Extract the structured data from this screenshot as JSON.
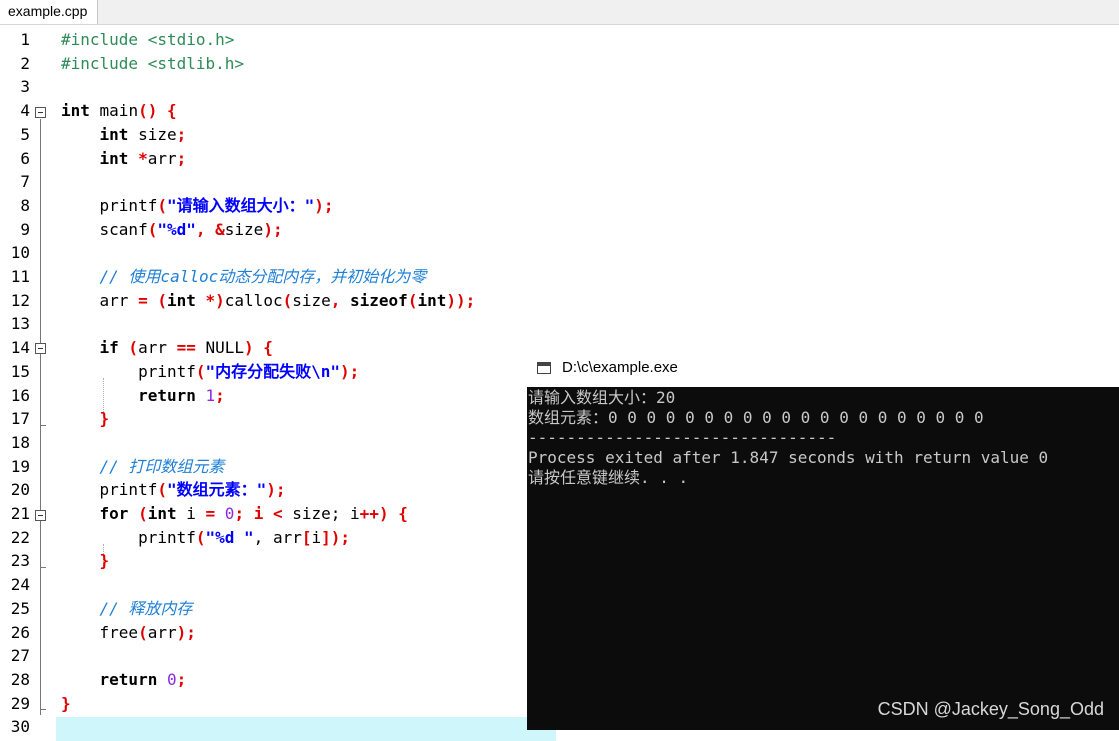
{
  "tab": {
    "label": "example.cpp"
  },
  "editor": {
    "line_numbers": [
      "1",
      "2",
      "3",
      "4",
      "5",
      "6",
      "7",
      "8",
      "9",
      "10",
      "11",
      "12",
      "13",
      "14",
      "15",
      "16",
      "17",
      "18",
      "19",
      "20",
      "21",
      "22",
      "23",
      "24",
      "25",
      "26",
      "27",
      "28",
      "29",
      "30"
    ],
    "lines": {
      "l1": {
        "a": "#include <stdio.h>"
      },
      "l2": {
        "a": "#include <stdlib.h>"
      },
      "l4": {
        "a": "int",
        "b": " main",
        "c": "() {"
      },
      "l5": {
        "a": "    ",
        "b": "int",
        "c": " size",
        "d": ";"
      },
      "l6": {
        "a": "    ",
        "b": "int",
        "c": " ",
        "d": "*",
        "e": "arr",
        "f": ";"
      },
      "l8": {
        "a": "    printf",
        "b": "(",
        "c": "\"请输入数组大小：\"",
        "d": ");"
      },
      "l9": {
        "a": "    scanf",
        "b": "(",
        "c": "\"%d\"",
        "d": ", &",
        "e": "size",
        "f": ");"
      },
      "l11": {
        "a": "    // 使用calloc动态分配内存，并初始化为零"
      },
      "l12": {
        "a": "    arr ",
        "b": "=",
        "c": " (",
        "d": "int",
        "e": " *",
        "f": ")",
        "g": "calloc",
        "h": "(",
        "i": "size",
        "j": ", ",
        "k": "sizeof",
        "l": "(",
        "m": "int",
        "n": "));"
      },
      "l14": {
        "a": "    ",
        "b": "if",
        "c": " (",
        "d": "arr ",
        "e": "==",
        "f": " NULL",
        "g": ") {"
      },
      "l15": {
        "a": "        printf",
        "b": "(",
        "c": "\"内存分配失败\\n\"",
        "d": ");"
      },
      "l16": {
        "a": "        ",
        "b": "return",
        "c": " ",
        "d": "1",
        "e": ";"
      },
      "l17": {
        "a": "    }"
      },
      "l19": {
        "a": "    // 打印数组元素"
      },
      "l20": {
        "a": "    printf",
        "b": "(",
        "c": "\"数组元素：\"",
        "d": ");"
      },
      "l21": {
        "a": "    ",
        "b": "for",
        "c": " (",
        "d": "int",
        "e": " i ",
        "f": "=",
        "g": " ",
        "h": "0",
        "i": "; i ",
        "j": "<",
        "k": " size; i",
        "l": "++",
        "m": ") {"
      },
      "l22": {
        "a": "        printf",
        "b": "(",
        "c": "\"%d \"",
        "d": ", arr",
        "e": "[",
        "f": "i",
        "g": "]);"
      },
      "l23": {
        "a": "    }"
      },
      "l25": {
        "a": "    // 释放内存"
      },
      "l26": {
        "a": "    free",
        "b": "(",
        "c": "arr",
        "d": ");"
      },
      "l28": {
        "a": "    ",
        "b": "return",
        "c": " ",
        "d": "0",
        "e": ";"
      },
      "l29": {
        "a": "}"
      }
    }
  },
  "console": {
    "title": "D:\\c\\example.exe",
    "lines": [
      "请输入数组大小：20",
      "数组元素：0 0 0 0 0 0 0 0 0 0 0 0 0 0 0 0 0 0 0 0",
      "--------------------------------",
      "Process exited after 1.847 seconds with return value 0",
      "请按任意键继续. . ."
    ]
  },
  "watermark": "CSDN @Jackey_Song_Odd",
  "colors": {
    "console_bg": "#0c0c0c",
    "keyword": "#000000",
    "string": "#0000ff",
    "comment": "#1e7fd6",
    "operator": "#e00000",
    "number": "#8a2be2",
    "preprocessor": "#2e8b57",
    "highlight": "#cff7fb"
  },
  "icons": {
    "console": "console-window-icon",
    "fold": "fold-collapse-icon"
  }
}
